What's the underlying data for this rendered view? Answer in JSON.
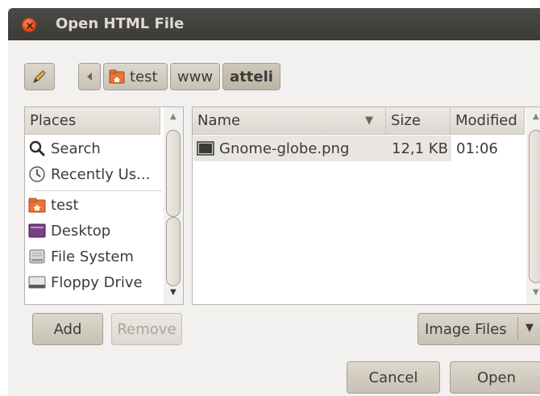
{
  "window": {
    "title": "Open HTML File"
  },
  "breadcrumb": [
    "test",
    "www",
    "atteli"
  ],
  "places": {
    "header": "Places",
    "items": [
      {
        "label": "Search",
        "icon": "search-icon"
      },
      {
        "label": "Recently Us...",
        "icon": "clock-icon"
      },
      {
        "label": "test",
        "icon": "home-folder-icon"
      },
      {
        "label": "Desktop",
        "icon": "desktop-icon"
      },
      {
        "label": "File System",
        "icon": "harddisk-icon"
      },
      {
        "label": "Floppy Drive",
        "icon": "floppy-icon"
      }
    ]
  },
  "files": {
    "columns": {
      "name": "Name",
      "size": "Size",
      "modified": "Modified"
    },
    "rows": [
      {
        "name": "Gnome-globe.png",
        "size": "12,1 KB",
        "modified": "01:06"
      }
    ]
  },
  "buttons": {
    "add": "Add",
    "remove": "Remove",
    "cancel": "Cancel",
    "open": "Open"
  },
  "filter": {
    "selected": "Image Files"
  },
  "colors": {
    "titlebar": "#3c3b37",
    "close": "#df4a16",
    "window": "#f2f1f0"
  }
}
